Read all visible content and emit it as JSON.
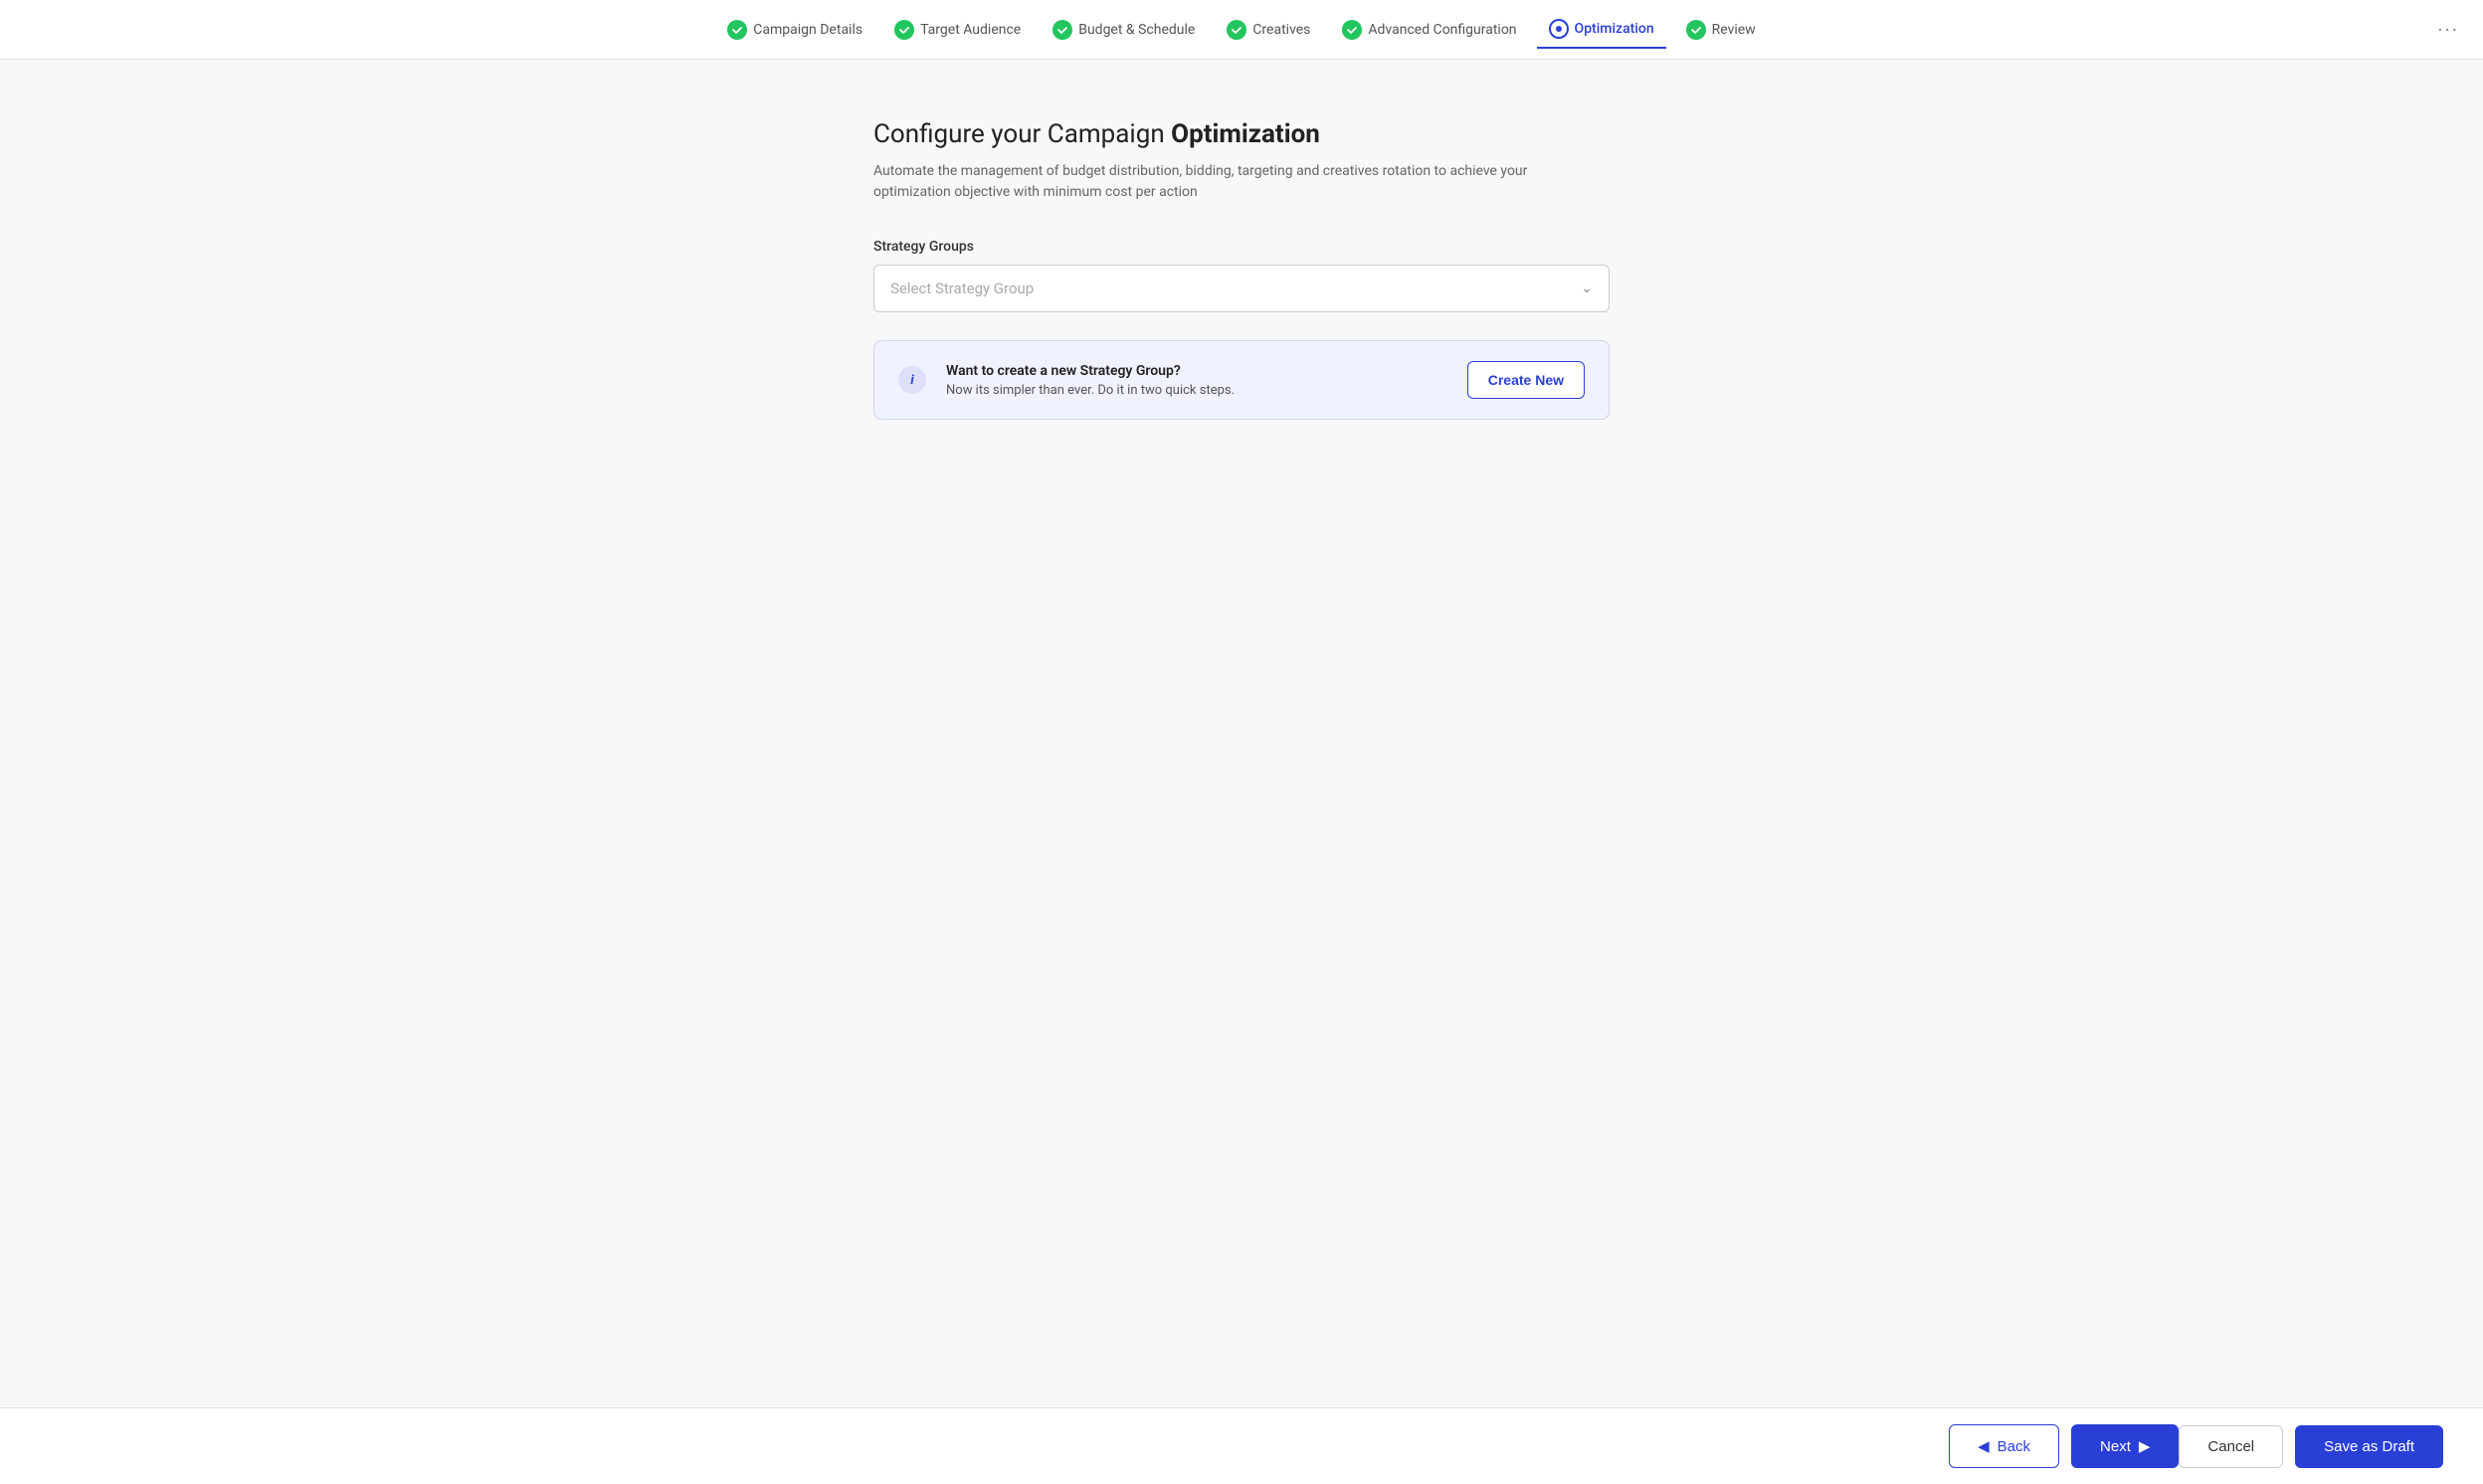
{
  "nav": {
    "steps": [
      {
        "id": "campaign-details",
        "label": "Campaign Details",
        "state": "completed"
      },
      {
        "id": "target-audience",
        "label": "Target Audience",
        "state": "completed"
      },
      {
        "id": "budget-schedule",
        "label": "Budget & Schedule",
        "state": "completed"
      },
      {
        "id": "creatives",
        "label": "Creatives",
        "state": "completed"
      },
      {
        "id": "advanced-configuration",
        "label": "Advanced Configuration",
        "state": "completed"
      },
      {
        "id": "optimization",
        "label": "Optimization",
        "state": "active"
      },
      {
        "id": "review",
        "label": "Review",
        "state": "completed"
      }
    ],
    "more_label": "···"
  },
  "page": {
    "title_prefix": "Configure your Campaign ",
    "title_bold": "Optimization",
    "subtitle": "Automate the management of budget distribution, bidding, targeting and creatives rotation to achieve your optimization objective with minimum cost per action"
  },
  "form": {
    "strategy_groups_label": "Strategy Groups",
    "strategy_dropdown_placeholder": "Select Strategy Group"
  },
  "info_box": {
    "icon": "i",
    "title": "Want to create a new Strategy Group?",
    "description": "Now its simpler than ever. Do it in two quick steps.",
    "create_button_label": "Create New"
  },
  "footer": {
    "back_label": "Back",
    "next_label": "Next",
    "cancel_label": "Cancel",
    "save_draft_label": "Save as Draft"
  }
}
